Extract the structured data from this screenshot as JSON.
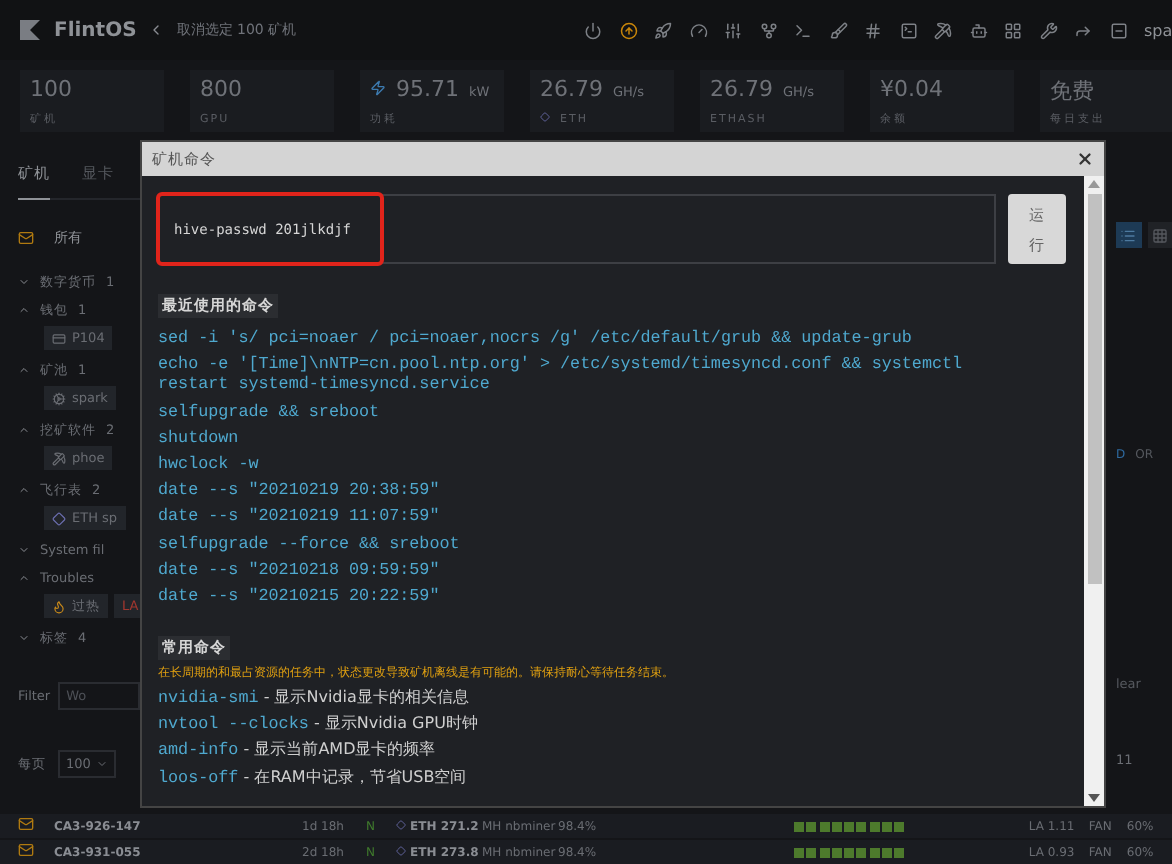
{
  "topbar": {
    "brand": "FlintOS",
    "breadcrumb": "取消选定 100 矿机",
    "user": "spa"
  },
  "stats": [
    {
      "kind": "plain",
      "value": "100",
      "label": "矿机"
    },
    {
      "kind": "plain",
      "value": "800",
      "label": "GPU"
    },
    {
      "kind": "power",
      "value": "95.71",
      "unit": "kW",
      "label": "功耗"
    },
    {
      "kind": "coin",
      "value": "26.79",
      "unit": "GH/s",
      "label": "ETH"
    },
    {
      "kind": "plain",
      "value": "26.79",
      "unit": "GH/s",
      "label": "ETHASH"
    },
    {
      "kind": "plain",
      "value": "¥0.04",
      "label": "余额"
    },
    {
      "kind": "plain",
      "value": "免费",
      "label": "每日支出"
    }
  ],
  "tabs": [
    {
      "label": "矿机",
      "selected": true
    },
    {
      "label": "显卡",
      "selected": false
    }
  ],
  "filters": [
    {
      "label": "所有",
      "selected": true
    }
  ],
  "tree": [
    {
      "label": "数字货币",
      "count": "1",
      "expanded": false
    },
    {
      "label": "钱包",
      "count": "1",
      "expanded": true,
      "children": [
        {
          "kind": "card",
          "label": "P104"
        }
      ]
    },
    {
      "label": "矿池",
      "count": "1",
      "expanded": true,
      "children": [
        {
          "kind": "pool",
          "label": "spark"
        }
      ]
    },
    {
      "label": "挖矿软件",
      "count": "2",
      "expanded": true,
      "children": [
        {
          "kind": "pick",
          "label": "phoe"
        }
      ]
    },
    {
      "label": "飞行表",
      "count": "2",
      "expanded": true,
      "children": [
        {
          "kind": "eth",
          "label": "ETH sp"
        }
      ]
    },
    {
      "label": "System fil",
      "expanded": false
    },
    {
      "label": "Troubles",
      "expanded": true,
      "children": [
        {
          "kind": "flame",
          "label": "过热"
        },
        {
          "kind": "la",
          "label": "LA"
        }
      ]
    },
    {
      "label": "标签",
      "count": "4",
      "expanded": false
    }
  ],
  "filter": {
    "label": "Filter",
    "placeholder": "Wo"
  },
  "per_page": {
    "label": "每页",
    "value": "100"
  },
  "view_modes": [
    {
      "selected": true
    },
    {
      "selected": false
    }
  ],
  "logic": [
    {
      "label": "D",
      "selected": true
    },
    {
      "label": "OR",
      "selected": false
    }
  ],
  "clear": "lear",
  "pager": "11",
  "rows": [
    {
      "name": "CA3-926-147",
      "uptime": "1d 18h",
      "status": "N",
      "coin": "ETH",
      "hashrate": "271.2",
      "unit": "MH",
      "miner": "nbminer",
      "share": "98.4%",
      "la": "LA 1.11",
      "fan": "FAN",
      "fan_pct": "60%"
    },
    {
      "name": "CA3-931-055",
      "uptime": "2d 18h",
      "status": "N",
      "coin": "ETH",
      "hashrate": "273.8",
      "unit": "MH",
      "miner": "nbminer",
      "share": "98.4%",
      "la": "LA 0.93",
      "fan": "FAN",
      "fan_pct": "60%"
    }
  ],
  "modal": {
    "title": "矿机命令",
    "command": "hive-passwd 201jlkdjf",
    "run_label": "运行",
    "sections": [
      {
        "title": "最近使用的命令",
        "commands": [
          {
            "code": "sed -i 's/ pci=noaer / pci=noaer,nocrs /g' /etc/default/grub && update-grub"
          },
          {
            "code": "echo -e '[Time]\\nNTP=cn.pool.ntp.org' > /etc/systemd/timesyncd.conf && systemctl restart systemd-timesyncd.service"
          },
          {
            "code": "selfupgrade && sreboot"
          },
          {
            "code": "shutdown"
          },
          {
            "code": "hwclock -w"
          },
          {
            "code": "date --s \"20210219 20:38:59\""
          },
          {
            "code": "date --s \"20210219 11:07:59\""
          },
          {
            "code": "selfupgrade --force && sreboot"
          },
          {
            "code": "date --s \"20210218 09:59:59\""
          },
          {
            "code": "date --s \"20210215 20:22:59\""
          }
        ]
      },
      {
        "title": "常用命令",
        "note": "在长周期的和最占资源的任务中，状态更改导致矿机离线是有可能的。请保持耐心等待任务结束。",
        "commands": [
          {
            "code": "nvidia-smi",
            "desc": "- 显示Nvidia显卡的相关信息"
          },
          {
            "code": "nvtool --clocks",
            "desc": "- 显示Nvidia GPU时钟"
          },
          {
            "code": "amd-info",
            "desc": "- 显示当前AMD显卡的频率"
          },
          {
            "code": "loos-off",
            "desc": "- 在RAM中记录，节省USB空间"
          }
        ]
      }
    ]
  }
}
